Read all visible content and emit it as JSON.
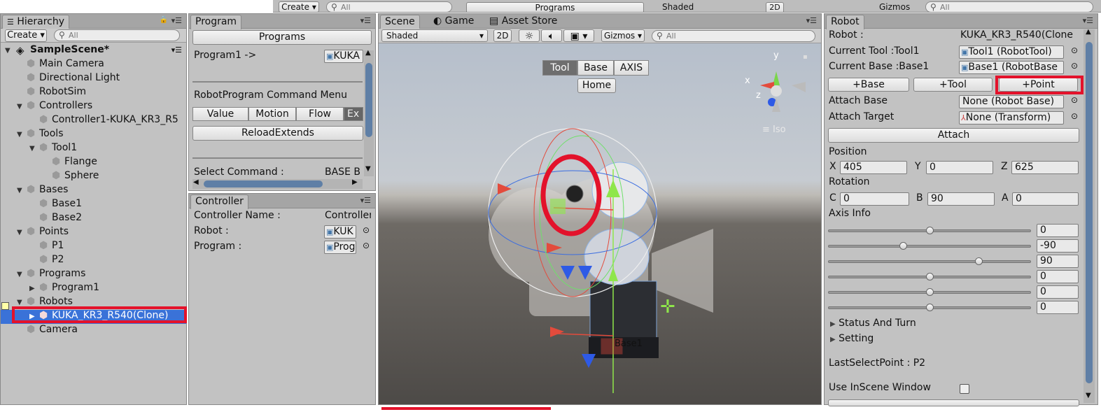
{
  "top_strip": {
    "create": "Create",
    "search_placeholder": "All",
    "programs": "Programs",
    "shaded": "Shaded",
    "btn_2d": "2D",
    "gizmos": "Gizmos",
    "search2_placeholder": "All"
  },
  "hierarchy": {
    "tab": "Hierarchy",
    "create": "Create",
    "search_placeholder": "All",
    "scene": "SampleScene*",
    "items": [
      {
        "label": "Main Camera"
      },
      {
        "label": "Directional Light"
      },
      {
        "label": "RobotSim"
      },
      {
        "label": "Controllers"
      },
      {
        "label": "Controller1-KUKA_KR3_R5"
      },
      {
        "label": "Tools"
      },
      {
        "label": "Tool1"
      },
      {
        "label": "Flange"
      },
      {
        "label": "Sphere"
      },
      {
        "label": "Bases"
      },
      {
        "label": "Base1"
      },
      {
        "label": "Base2"
      },
      {
        "label": "Points"
      },
      {
        "label": "P1"
      },
      {
        "label": "P2"
      },
      {
        "label": "Programs"
      },
      {
        "label": "Program1"
      },
      {
        "label": "Robots"
      },
      {
        "label": "KUKA_KR3_R540(Clone)"
      },
      {
        "label": "Camera"
      }
    ]
  },
  "program": {
    "tab": "Program",
    "programs_btn": "Programs",
    "program1": "Program1 ->",
    "program1_field": "KUKA",
    "menu_title": "RobotProgram Command Menu",
    "tabs": [
      "Value",
      "Motion",
      "Flow",
      "Ex"
    ],
    "reload": "ReloadExtends",
    "select_cmd": "Select Command :",
    "select_val": "BASE B"
  },
  "controller": {
    "tab": "Controller",
    "name_label": "Controller Name :",
    "name_val": "Controller",
    "robot_label": "Robot :",
    "robot_val": "KUK",
    "program_label": "Program :",
    "program_val": "Prog"
  },
  "scene": {
    "tabs": [
      "Scene",
      "Game",
      "Asset Store"
    ],
    "shaded": "Shaded",
    "btn_2d": "2D",
    "gizmos": "Gizmos",
    "search_placeholder": "All",
    "mode_tabs": [
      "Tool",
      "Base",
      "AXIS"
    ],
    "home": "Home",
    "base_label": "Base1",
    "iso": "Iso",
    "axis_y": "y",
    "axis_x": "x",
    "axis_z": "z"
  },
  "robot": {
    "tab": "Robot",
    "robot_label": "Robot :",
    "robot_val": "KUKA_KR3_R540(Clone",
    "tool_label": "Current Tool :Tool1",
    "tool_val": "Tool1 (RobotTool)",
    "base_label": "Current Base :Base1",
    "base_val": "Base1 (RobotBase",
    "btn_base": "+Base",
    "btn_tool": "+Tool",
    "btn_point": "+Point",
    "attach_base_label": "Attach Base",
    "attach_base_val": "None (Robot Base)",
    "attach_target_label": "Attach Target",
    "attach_target_val": "None (Transform)",
    "attach_btn": "Attach",
    "position": "Position",
    "pos": {
      "x_label": "X",
      "x": "405",
      "y_label": "Y",
      "y": "0",
      "z_label": "Z",
      "z": "625"
    },
    "rotation": "Rotation",
    "rot": {
      "c_label": "C",
      "c": "0",
      "b_label": "B",
      "b": "90",
      "a_label": "A",
      "a": "0"
    },
    "axis_info": "Axis Info",
    "axes": [
      {
        "value": "0",
        "fraction": 0.5
      },
      {
        "value": "-90",
        "fraction": 0.37
      },
      {
        "value": "90",
        "fraction": 0.74
      },
      {
        "value": "0",
        "fraction": 0.5
      },
      {
        "value": "0",
        "fraction": 0.5
      },
      {
        "value": "0",
        "fraction": 0.5
      }
    ],
    "status_turn": "Status And Turn",
    "setting": "Setting",
    "last_select": "LastSelectPoint : P2",
    "use_inscene": "Use InScene Window"
  },
  "colors": {
    "highlight_red": "#e3122b",
    "selection_blue": "#3a72d8",
    "panel_gray": "#c2c2c2"
  }
}
